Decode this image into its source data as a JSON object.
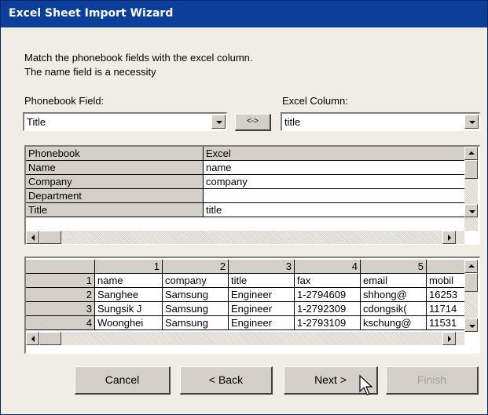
{
  "window": {
    "title": "Excel Sheet Import Wizard"
  },
  "instructions": {
    "line1": "Match the phonebook fields with the excel column.",
    "line2": "The name field is a necessity"
  },
  "phonebook_field": {
    "label": "Phonebook Field:",
    "selected": "Title"
  },
  "excel_column": {
    "label": "Excel Column:",
    "selected": "title"
  },
  "swap_button": {
    "label": "<->"
  },
  "mapping_table": {
    "headers": [
      "Phonebook",
      "Excel"
    ],
    "rows": [
      {
        "phonebook": "Name",
        "excel": "name"
      },
      {
        "phonebook": "Company",
        "excel": "company"
      },
      {
        "phonebook": "Department",
        "excel": ""
      },
      {
        "phonebook": "Title",
        "excel": "title"
      }
    ]
  },
  "preview_table": {
    "column_numbers": [
      "1",
      "2",
      "3",
      "4",
      "5",
      ""
    ],
    "rows": [
      {
        "num": "1",
        "cells": [
          "name",
          "company",
          "title",
          "fax",
          "email",
          "mobil"
        ]
      },
      {
        "num": "2",
        "cells": [
          "Sanghee",
          "Samsung",
          "Engineer",
          "1-2794609",
          "shhong@",
          "16253"
        ]
      },
      {
        "num": "3",
        "cells": [
          "Sungsik J",
          "Samsung",
          "Engineer",
          "1-2792309",
          "cdongsik(",
          "11714"
        ]
      },
      {
        "num": "4",
        "cells": [
          "Woonghei",
          "Samsung",
          "Engineer",
          "1-2793109",
          "kschung@",
          "11531"
        ]
      }
    ]
  },
  "buttons": {
    "cancel": "Cancel",
    "back": "< Back",
    "next": "Next >",
    "finish": "Finish"
  },
  "colors": {
    "titlebar": "#0b3f9a",
    "dialog_bg": "#f0ede4",
    "button_face": "#d4d0c8"
  }
}
